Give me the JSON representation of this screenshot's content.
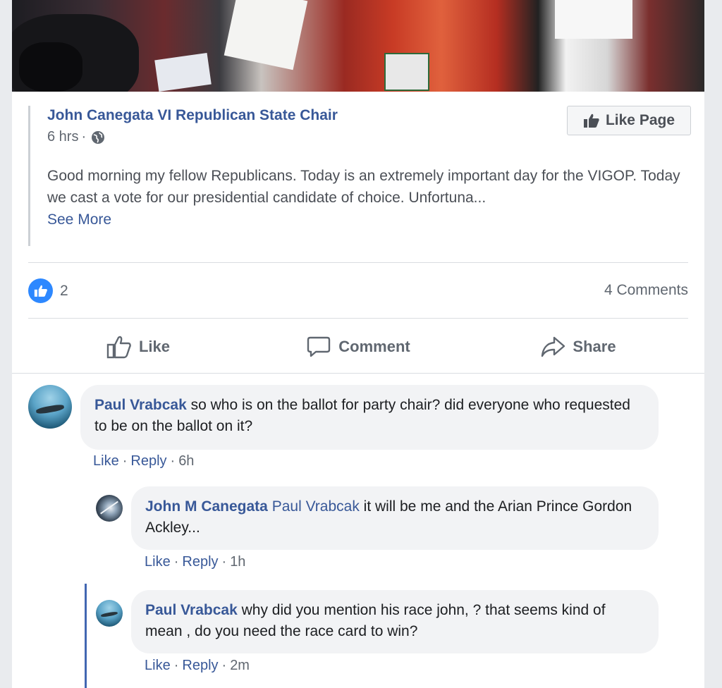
{
  "post": {
    "page_name": "John Canegata VI Republican State Chair",
    "time": "6 hrs",
    "time_separator": "·",
    "like_page_label": "Like Page",
    "text": "Good morning my fellow Republicans. Today is an extremely important day for the VIGOP. Today we cast a vote for our presidential candidate of choice. Unfortuna...",
    "see_more": "See More",
    "reaction_count": "2",
    "comment_count": "4 Comments"
  },
  "actions": {
    "like": "Like",
    "comment": "Comment",
    "share": "Share"
  },
  "comments": [
    {
      "author": "Paul Vrabcak",
      "text": "so who is on the ballot for party chair? did everyone who requested to be on the ballot on it?",
      "like": "Like",
      "reply": "Reply",
      "time": "6h"
    },
    {
      "author": "John M Canegata",
      "mention": "Paul Vrabcak",
      "text": "it will be me and the Arian Prince Gordon Ackley...",
      "like": "Like",
      "reply": "Reply",
      "time": "1h"
    },
    {
      "author": "Paul Vrabcak",
      "text": "why did you mention his race john, ? that seems kind of mean , do you need the race card to win?",
      "like": "Like",
      "reply": "Reply",
      "time": "2m"
    }
  ],
  "separators": {
    "dot": "·"
  },
  "colors": {
    "link": "#385898",
    "accent": "#2d88ff",
    "reply_bar": "#4267b2"
  }
}
